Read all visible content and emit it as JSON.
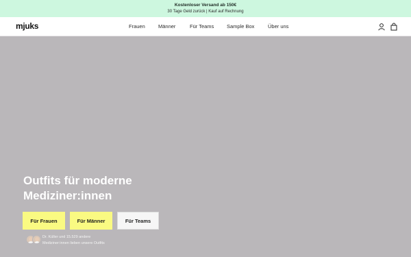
{
  "announcement": {
    "line1": "Kostenloser Versand ab 150€",
    "line2": "30 Tage Geld zurück | Kauf auf Rechnung"
  },
  "header": {
    "logo": "mjuks",
    "nav": [
      {
        "label": "Frauen"
      },
      {
        "label": "Männer"
      },
      {
        "label": "Für Teams"
      },
      {
        "label": "Sample Box"
      },
      {
        "label": "Über uns"
      }
    ],
    "icons": [
      "account-icon",
      "cart-icon"
    ]
  },
  "hero": {
    "background_color": "#bab7ba",
    "headline_line1": "Outfits für moderne",
    "headline_line2": "Mediziner:innen",
    "buttons": [
      {
        "label": "Für Frauen",
        "style": "yellow"
      },
      {
        "label": "Für Männer",
        "style": "yellow"
      },
      {
        "label": "Für Teams",
        "style": "white"
      }
    ],
    "social_proof_line1": "Dr. Küller und 15.529 andere",
    "social_proof_line2": "Mediziner:innen lieben unsere Outfits"
  },
  "colors": {
    "announcement_bg": "#cdf7df",
    "cta_yellow": "#fafa82",
    "hero_bg": "#bab7ba"
  }
}
